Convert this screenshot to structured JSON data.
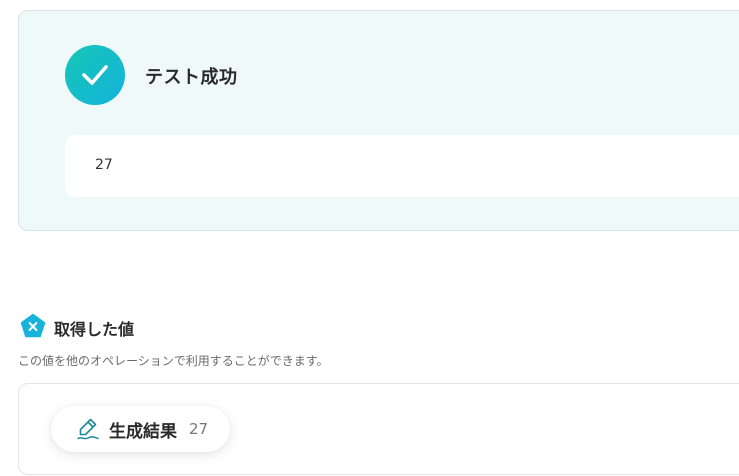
{
  "result": {
    "status_title": "テスト成功",
    "output_value": "27",
    "status_icon": "check-icon",
    "accent_color": "#16c6b5"
  },
  "acquired": {
    "title": "取得した値",
    "icon": "variable-x-icon",
    "description": "この値を他のオペレーションで利用することができます。",
    "items": [
      {
        "label": "生成結果",
        "value": "27",
        "icon": "pen-icon"
      }
    ]
  }
}
